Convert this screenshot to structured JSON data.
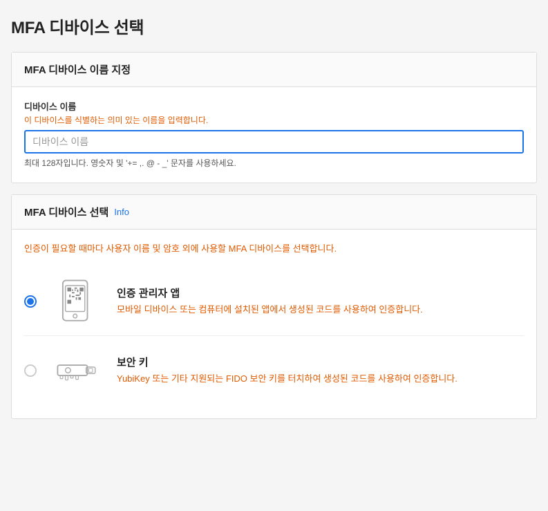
{
  "page": {
    "title": "MFA 디바이스 선택"
  },
  "name_section": {
    "header": "MFA 디바이스 이름 지정",
    "field_label": "디바이스 이름",
    "field_hint": "이 디바이스를 식별하는 의미 있는 이름을 입력합니다.",
    "field_placeholder": "디바이스 이름",
    "field_note": "최대 128자입니다. 영숫자 및 '+= ,. @ - _' 문자를 사용하세요."
  },
  "select_section": {
    "header": "MFA 디바이스 선택",
    "info_label": "Info",
    "description": "인증이 필요할 때마다 사용자 이름 및 암호 외에 사용할 MFA 디바이스를 선택합니다.",
    "options": [
      {
        "id": "authenticator",
        "title": "인증 관리자 앱",
        "description": "모바일 디바이스 또는 컴퓨터에 설치된 앱에서 생성된 코드를 사용하여 인증합니다.",
        "selected": true,
        "icon": "phone"
      },
      {
        "id": "security-key",
        "title": "보안 키",
        "description": "YubiKey 또는 기타 지원되는 FIDO 보안 키를 터치하여 생성된 코드를 사용하여 인증합니다.",
        "selected": false,
        "icon": "key"
      }
    ]
  }
}
